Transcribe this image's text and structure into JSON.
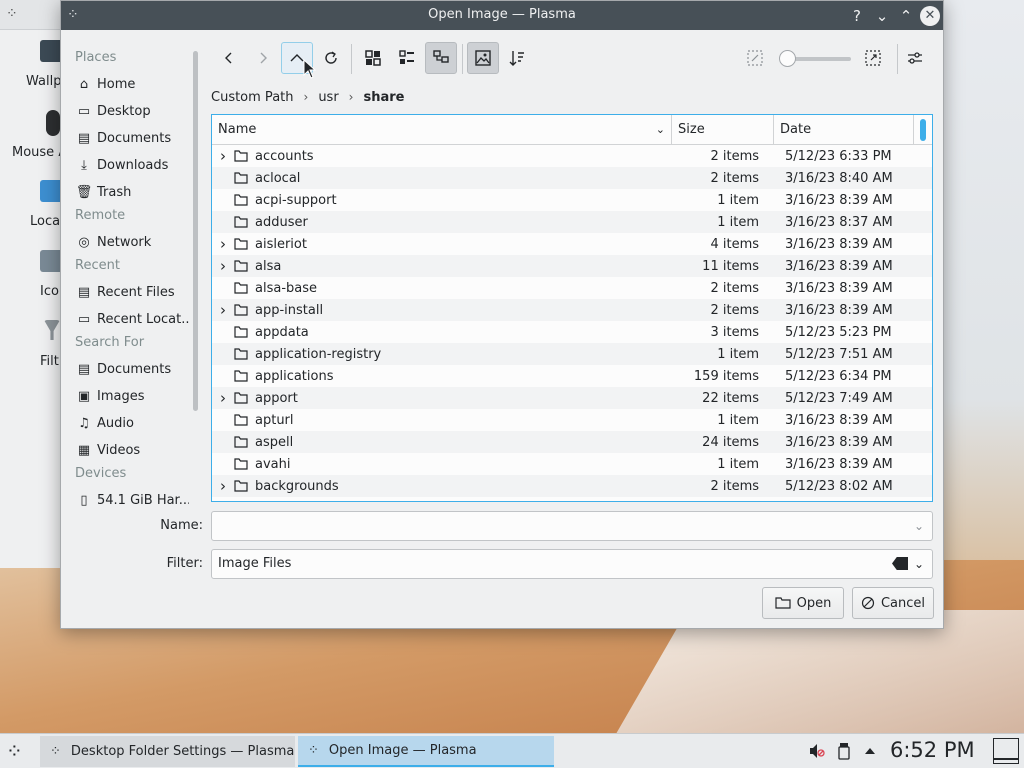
{
  "dialog": {
    "title": "Open Image — Plasma",
    "help_glyph": "?",
    "minimize_glyph": "⌄",
    "maximize_glyph": "⌃",
    "close_glyph": "✕"
  },
  "background_window": {
    "labels": [
      "Wallp",
      "Mouse A",
      "Loca",
      "Ico",
      "Filt"
    ]
  },
  "places": {
    "sections": [
      {
        "title": "Places",
        "items": [
          {
            "label": "Home",
            "icon": "home-icon"
          },
          {
            "label": "Desktop",
            "icon": "desktop-icon"
          },
          {
            "label": "Documents",
            "icon": "documents-icon"
          },
          {
            "label": "Downloads",
            "icon": "downloads-icon"
          },
          {
            "label": "Trash",
            "icon": "trash-icon"
          }
        ]
      },
      {
        "title": "Remote",
        "items": [
          {
            "label": "Network",
            "icon": "network-icon"
          }
        ]
      },
      {
        "title": "Recent",
        "items": [
          {
            "label": "Recent Files",
            "icon": "recent-files-icon"
          },
          {
            "label": "Recent Locat...",
            "icon": "recent-locations-icon"
          }
        ]
      },
      {
        "title": "Search For",
        "items": [
          {
            "label": "Documents",
            "icon": "documents-icon"
          },
          {
            "label": "Images",
            "icon": "images-icon"
          },
          {
            "label": "Audio",
            "icon": "audio-icon"
          },
          {
            "label": "Videos",
            "icon": "videos-icon"
          }
        ]
      },
      {
        "title": "Devices",
        "items": [
          {
            "label": "54.1 GiB Har...",
            "icon": "harddisk-icon"
          }
        ]
      }
    ]
  },
  "breadcrumb": {
    "items": [
      "Custom Path",
      "usr",
      "share"
    ]
  },
  "file_view": {
    "columns": [
      "Name",
      "Size",
      "Date"
    ],
    "rows": [
      {
        "name": "accounts",
        "size": "2 items",
        "date": "5/12/23 6:33 PM",
        "expandable": true
      },
      {
        "name": "aclocal",
        "size": "2 items",
        "date": "3/16/23 8:40 AM",
        "expandable": false
      },
      {
        "name": "acpi-support",
        "size": "1 item",
        "date": "3/16/23 8:39 AM",
        "expandable": false
      },
      {
        "name": "adduser",
        "size": "1 item",
        "date": "3/16/23 8:37 AM",
        "expandable": false
      },
      {
        "name": "aisleriot",
        "size": "4 items",
        "date": "3/16/23 8:39 AM",
        "expandable": true
      },
      {
        "name": "alsa",
        "size": "11 items",
        "date": "3/16/23 8:39 AM",
        "expandable": true
      },
      {
        "name": "alsa-base",
        "size": "2 items",
        "date": "3/16/23 8:39 AM",
        "expandable": false
      },
      {
        "name": "app-install",
        "size": "2 items",
        "date": "3/16/23 8:39 AM",
        "expandable": true
      },
      {
        "name": "appdata",
        "size": "3 items",
        "date": "5/12/23 5:23 PM",
        "expandable": false
      },
      {
        "name": "application-registry",
        "size": "1 item",
        "date": "5/12/23 7:51 AM",
        "expandable": false
      },
      {
        "name": "applications",
        "size": "159 items",
        "date": "5/12/23 6:34 PM",
        "expandable": false
      },
      {
        "name": "apport",
        "size": "22 items",
        "date": "5/12/23 7:49 AM",
        "expandable": true
      },
      {
        "name": "apturl",
        "size": "1 item",
        "date": "3/16/23 8:39 AM",
        "expandable": false
      },
      {
        "name": "aspell",
        "size": "24 items",
        "date": "3/16/23 8:39 AM",
        "expandable": false
      },
      {
        "name": "avahi",
        "size": "1 item",
        "date": "3/16/23 8:39 AM",
        "expandable": false
      },
      {
        "name": "backgrounds",
        "size": "2 items",
        "date": "5/12/23 8:02 AM",
        "expandable": true
      }
    ]
  },
  "form": {
    "name_label": "Name:",
    "name_value": "",
    "filter_label": "Filter:",
    "filter_value": "Image Files",
    "open_label": "Open",
    "cancel_label": "Cancel"
  },
  "taskbar": {
    "tasks": [
      "Desktop Folder Settings — Plasma",
      "Open Image — Plasma"
    ],
    "clock": "6:52 PM"
  },
  "colors": {
    "accent": "#3daee9",
    "titlebar": "#475057"
  }
}
